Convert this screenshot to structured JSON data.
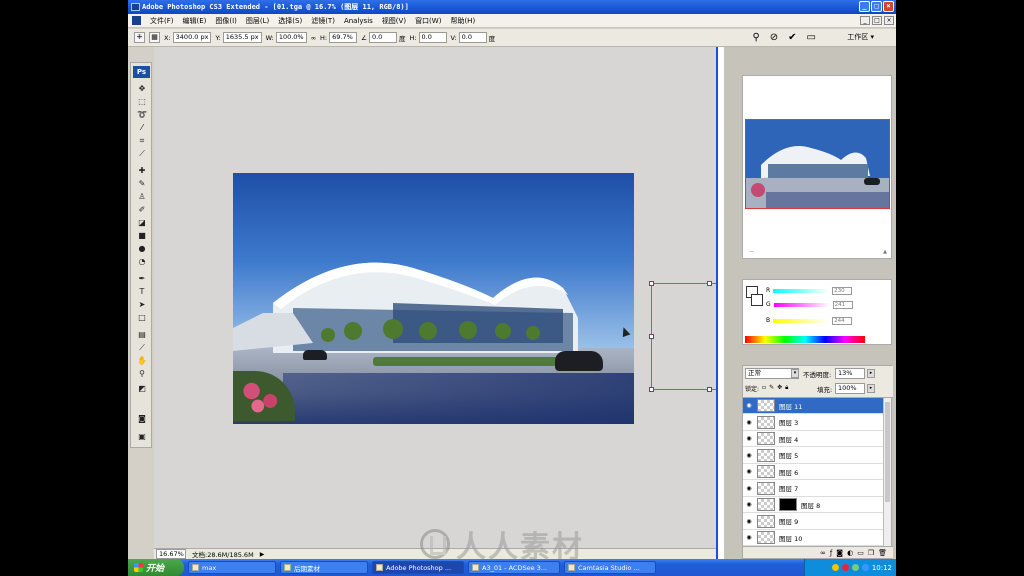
{
  "window": {
    "title": "Adobe Photoshop CS3 Extended - [01.tga @ 16.7% (图层 11, RGB/8)]",
    "buttons": [
      "_",
      "□",
      "×"
    ]
  },
  "menu": {
    "items": [
      "文件(F)",
      "编辑(E)",
      "图像(I)",
      "图层(L)",
      "选择(S)",
      "滤镜(T)",
      "Analysis",
      "视图(V)",
      "窗口(W)",
      "帮助(H)"
    ]
  },
  "options_bar": {
    "x_label": "X:",
    "x_value": "3400.0 px",
    "y_label": "Y:",
    "y_value": "1635.5 px",
    "w_label": "W:",
    "w_value": "100.0%",
    "h_label": "H:",
    "h_value": "69.7%",
    "angle_value": "0.0",
    "angle_unit": "度",
    "hskew_label": "H:",
    "hskew_value": "0.0",
    "hskew_unit": "度",
    "vskew_label": "V:",
    "vskew_value": "0.0",
    "vskew_unit": "度",
    "workspace_label": "工作区 ▾"
  },
  "toolbox": {
    "logo": "Ps"
  },
  "status_bar": {
    "zoom": "16.67%",
    "doc_info": "文档:28.6M/185.6M"
  },
  "navigator": {
    "zoom_marks": [
      "—",
      "▲"
    ]
  },
  "color_panel": {
    "r_label": "R",
    "g_label": "G",
    "b_label": "B",
    "r_value": "230",
    "g_value": "241",
    "b_value": "244"
  },
  "layers_panel": {
    "blend_mode": "正常",
    "opacity_label": "不透明度:",
    "opacity_value": "13%",
    "lock_label": "锁定:",
    "fill_label": "填充:",
    "fill_value": "100%",
    "layers": [
      {
        "name": "图层 11",
        "active": true,
        "mask": false
      },
      {
        "name": "图层 3",
        "active": false,
        "mask": false
      },
      {
        "name": "图层 4",
        "active": false,
        "mask": false
      },
      {
        "name": "图层 5",
        "active": false,
        "mask": false
      },
      {
        "name": "图层 6",
        "active": false,
        "mask": false
      },
      {
        "name": "图层 7",
        "active": false,
        "mask": false
      },
      {
        "name": "图层 8",
        "active": false,
        "mask": true
      },
      {
        "name": "图层 9",
        "active": false,
        "mask": false
      },
      {
        "name": "图层 10",
        "active": false,
        "mask": false
      }
    ]
  },
  "taskbar": {
    "start_label": "开始",
    "tasks": [
      {
        "label": "max",
        "active": false
      },
      {
        "label": "后期素材",
        "active": false
      },
      {
        "label": "Adobe Photoshop ...",
        "active": true
      },
      {
        "label": "A3_01 - ACDSee 3...",
        "active": false
      },
      {
        "label": "Camtasia Studio ...",
        "active": false
      }
    ],
    "clock": "10:12"
  },
  "watermark": {
    "text": "人人素材"
  }
}
